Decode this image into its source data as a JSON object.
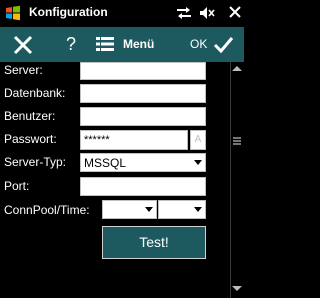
{
  "titlebar": {
    "title": "Konfiguration",
    "icons": [
      "windows-logo-icon",
      "sync-icon",
      "volume-icon",
      "close-icon"
    ]
  },
  "toolbar": {
    "help_label": "?",
    "menu_label": "Menü",
    "ok_label": "OK"
  },
  "form": {
    "server_label": "Server:",
    "server_value": "",
    "datenbank_label": "Datenbank:",
    "datenbank_value": "",
    "benutzer_label": "Benutzer:",
    "benutzer_value": "",
    "passwort_label": "Passwort:",
    "passwort_value": "******",
    "passwort_toggle": "A",
    "servertyp_label": "Server-Typ:",
    "servertyp_value": "MSSQL",
    "port_label": "Port:",
    "port_value": "",
    "connpool_label": "ConnPool/Time:",
    "connpool_value": "",
    "time_value": "",
    "test_button": "Test!"
  },
  "colors": {
    "toolbar_bg": "#1d5a5f",
    "background": "#000000",
    "field_bg": "#ffffff"
  }
}
